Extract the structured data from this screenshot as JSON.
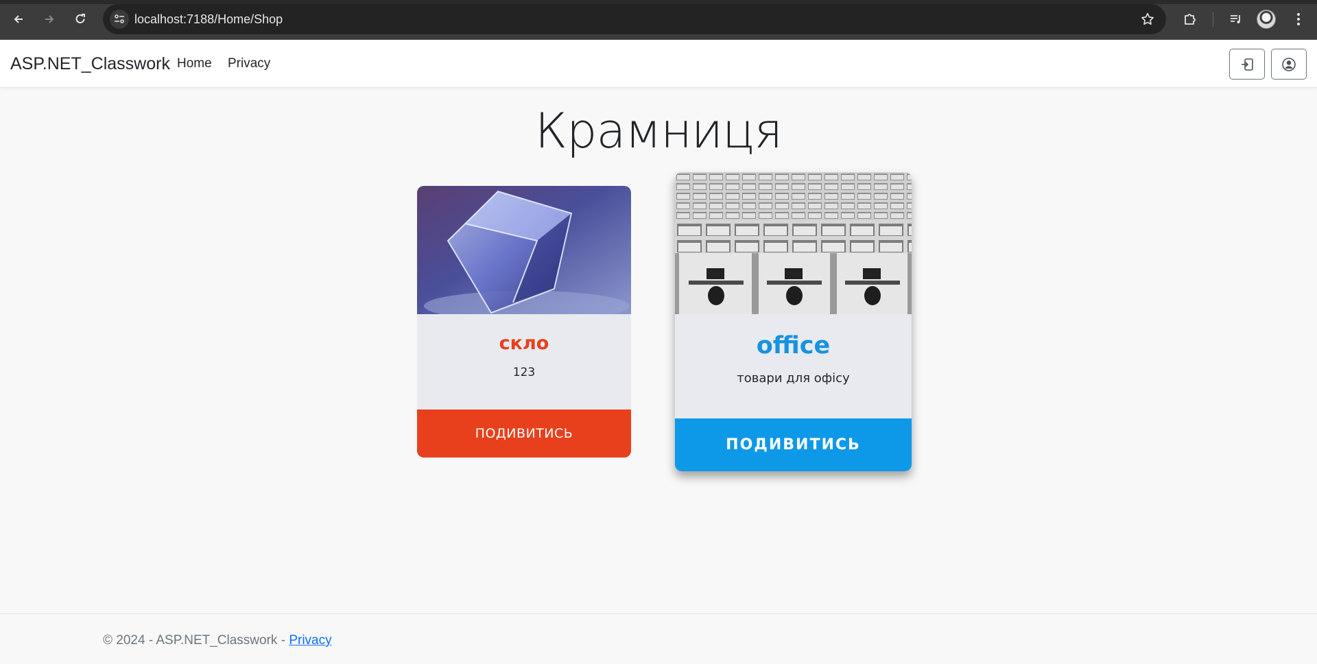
{
  "browser": {
    "url": "localhost:7188/Home/Shop",
    "back_icon": "arrow-left-icon",
    "forward_icon": "arrow-right-icon",
    "reload_icon": "reload-icon",
    "site_info_icon": "tune-icon",
    "bookmark_icon": "star-icon",
    "extensions_icon": "puzzle-icon",
    "media_icon": "playlist-icon",
    "menu_icon": "kebab-menu-icon"
  },
  "navbar": {
    "brand": "ASP.NET_Classwork",
    "links": [
      "Home",
      "Privacy"
    ],
    "login_icon": "login-icon",
    "profile_icon": "user-circle-icon"
  },
  "main": {
    "title": "Крамниця",
    "cards": [
      {
        "title": "скло",
        "description": "123",
        "button": "ПОДИВИТИСЬ",
        "accent": "#e8401c",
        "image": "glass-cube-photo"
      },
      {
        "title": "office",
        "description": "товари для офісу",
        "button": "ПОДИВИТИСЬ",
        "accent": "#0e99e8",
        "image": "office-cubicles-photo"
      }
    ]
  },
  "footer": {
    "text": "© 2024 - ASP.NET_Classwork - ",
    "link": "Privacy"
  }
}
